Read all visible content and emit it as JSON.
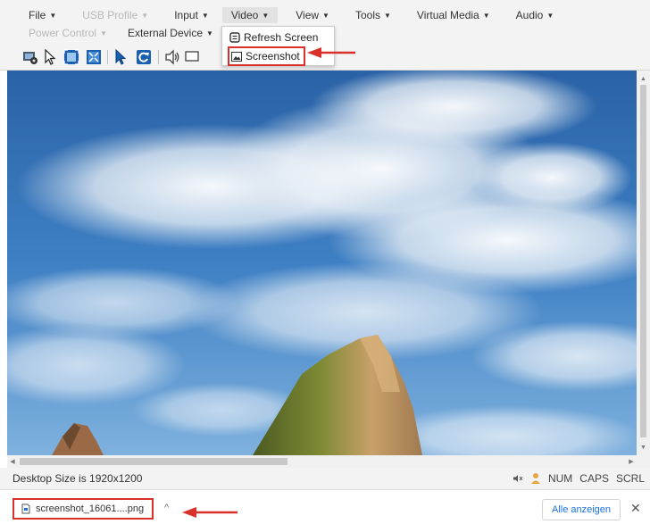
{
  "menu": {
    "file": "File",
    "usb_profile": "USB Profile",
    "input": "Input",
    "video": "Video",
    "view": "View",
    "tools": "Tools",
    "virtual_media": "Virtual Media",
    "audio": "Audio",
    "power_control": "Power Control",
    "external_device": "External Device",
    "caret": "▼"
  },
  "video_dropdown": {
    "refresh_screen": "Refresh Screen",
    "screenshot": "Screenshot"
  },
  "toolbar": {
    "icons": [
      "settings-icon",
      "pointer-icon",
      "fullscreen-icon",
      "fit-screen-icon",
      "cursor-sync-icon",
      "refresh-icon",
      "speaker-icon"
    ]
  },
  "status_bar": {
    "desktop_size": "Desktop Size is 1920x1200",
    "num": "NUM",
    "caps": "CAPS",
    "scrl": "SCRL"
  },
  "download_bar": {
    "filename": "screenshot_16061....png",
    "show_all": "Alle anzeigen",
    "close": "✕",
    "chevron": "^"
  },
  "colors": {
    "highlight_red": "#d9302b",
    "link_blue": "#1a73e8",
    "sky_blue": "#3a7cc0"
  }
}
